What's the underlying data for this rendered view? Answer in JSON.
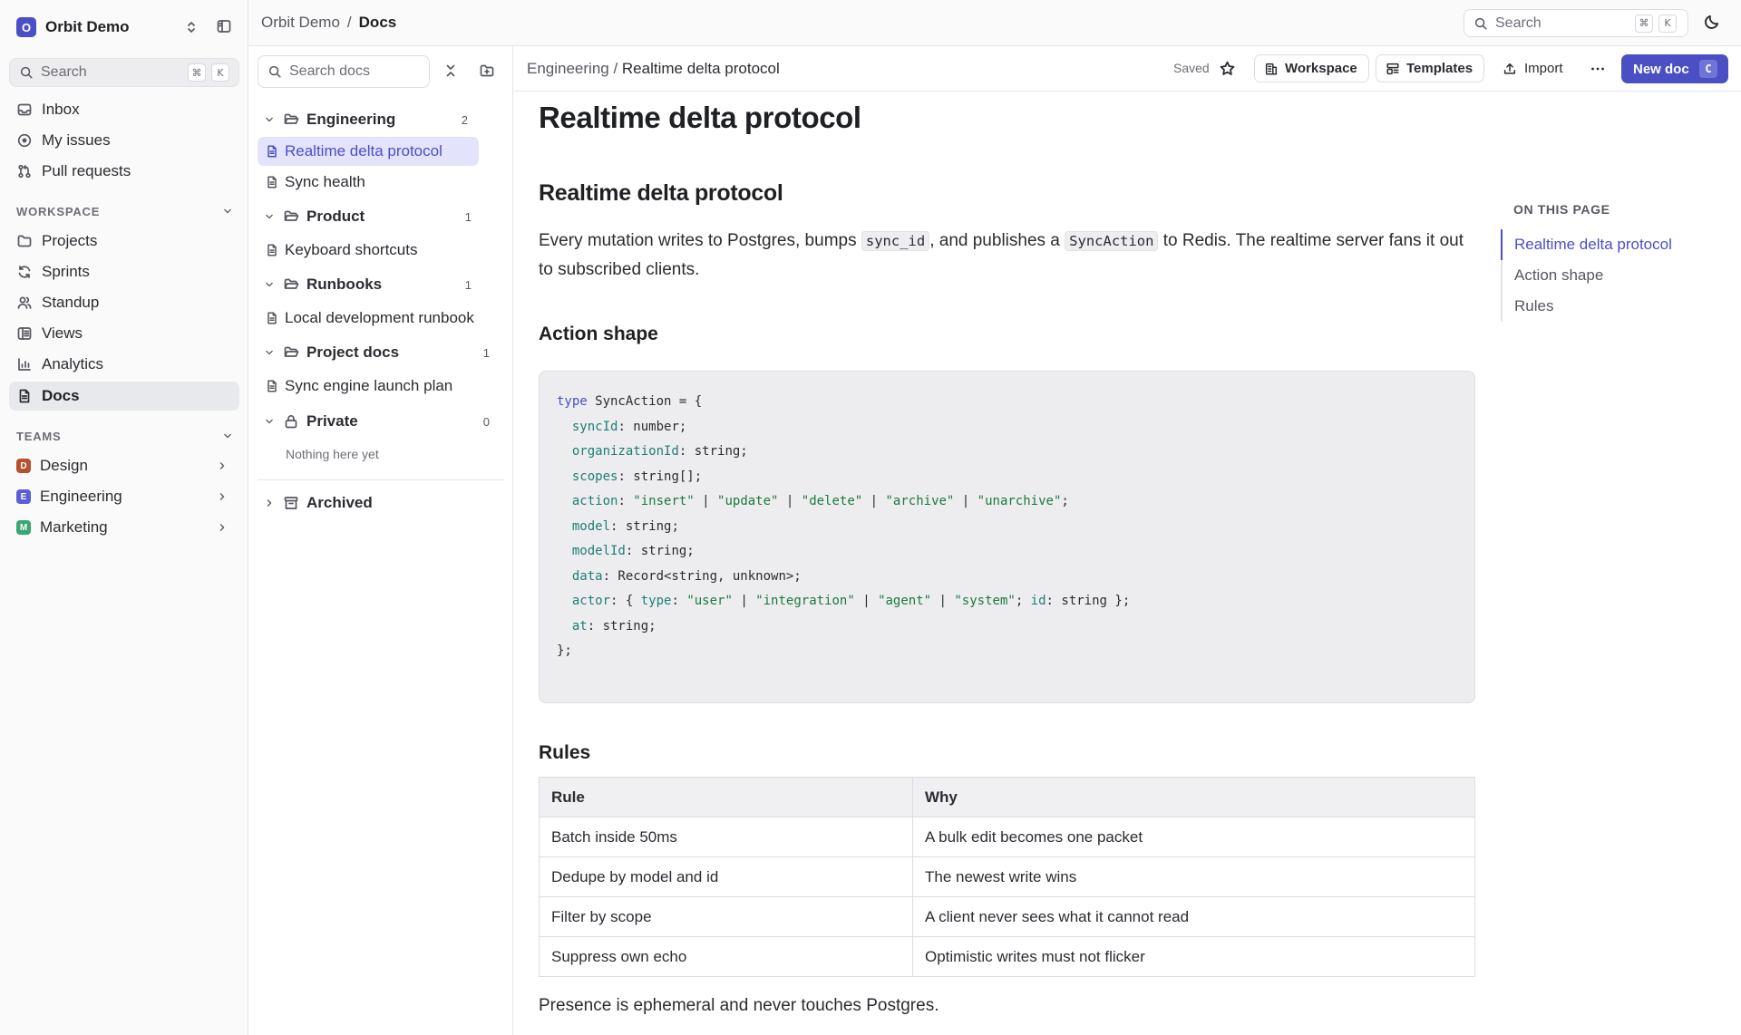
{
  "workspace": {
    "initial": "O",
    "name": "Orbit Demo"
  },
  "sidebar": {
    "search_placeholder": "Search",
    "search_keys": [
      "⌘",
      "K"
    ],
    "nav": [
      {
        "label": "Inbox",
        "icon": "inbox-icon"
      },
      {
        "label": "My issues",
        "icon": "issue-icon"
      },
      {
        "label": "Pull requests",
        "icon": "pull-request-icon"
      }
    ],
    "workspace_section": {
      "title": "WORKSPACE",
      "items": [
        {
          "label": "Projects",
          "icon": "folder-icon"
        },
        {
          "label": "Sprints",
          "icon": "cycle-icon"
        },
        {
          "label": "Standup",
          "icon": "users-icon"
        },
        {
          "label": "Views",
          "icon": "views-icon"
        },
        {
          "label": "Analytics",
          "icon": "chart-icon"
        },
        {
          "label": "Docs",
          "icon": "doc-icon",
          "active": true
        }
      ]
    },
    "teams_section": {
      "title": "TEAMS",
      "items": [
        {
          "initial": "D",
          "label": "Design",
          "color": "#b5532e"
        },
        {
          "initial": "E",
          "label": "Engineering",
          "color": "#5b5fd6"
        },
        {
          "initial": "M",
          "label": "Marketing",
          "color": "#3aa772"
        }
      ]
    }
  },
  "topbar": {
    "breadcrumb": [
      "Orbit Demo",
      "/",
      "Docs"
    ],
    "search_placeholder": "Search",
    "search_keys": [
      "⌘",
      "K"
    ]
  },
  "tree": {
    "search_placeholder": "Search docs",
    "folders": [
      {
        "name": "Engineering",
        "count": "2",
        "docs": [
          "Realtime delta protocol",
          "Sync health"
        ]
      },
      {
        "name": "Product",
        "count": "1",
        "docs": [
          "Keyboard shortcuts"
        ]
      },
      {
        "name": "Runbooks",
        "count": "1",
        "docs": [
          "Local development runbook"
        ]
      },
      {
        "name": "Project docs",
        "count": "1",
        "docs": [
          "Sync engine launch plan"
        ]
      },
      {
        "name": "Private",
        "count": "0",
        "empty_text": "Nothing here yet"
      },
      {
        "name": "Archived"
      }
    ],
    "active_doc": "Realtime delta protocol"
  },
  "doc_toolbar": {
    "breadcrumb_parent": "Engineering / ",
    "breadcrumb_current": "Realtime delta protocol",
    "saved": "Saved",
    "workspace_btn": "Workspace",
    "templates_btn": "Templates",
    "import_btn": "Import",
    "new_doc_btn": "New doc",
    "new_doc_key": "C"
  },
  "document": {
    "title": "Realtime delta protocol",
    "h1": "Realtime delta protocol",
    "intro": {
      "t1": "Every mutation writes to Postgres, bumps ",
      "c1": "sync_id",
      "t2": ", and publishes a ",
      "c2": "SyncAction",
      "t3": " to Redis. The realtime server fans it out to subscribed clients."
    },
    "h_action": "Action shape",
    "code_lines": [
      "type SyncAction = {",
      "  syncId: number;",
      "  organizationId: string;",
      "  scopes: string[];",
      "  action: \"insert\" | \"update\" | \"delete\" | \"archive\" | \"unarchive\";",
      "  model: string;",
      "  modelId: string;",
      "  data: Record<string, unknown>;",
      "  actor: { type: \"user\" | \"integration\" | \"agent\" | \"system\"; id: string };",
      "  at: string;",
      "};"
    ],
    "h_rules": "Rules",
    "rules_table": {
      "headers": [
        "Rule",
        "Why"
      ],
      "rows": [
        [
          "Batch inside 50ms",
          "A bulk edit becomes one packet"
        ],
        [
          "Dedupe by model and id",
          "The newest write wins"
        ],
        [
          "Filter by scope",
          "A client never sees what it cannot read"
        ],
        [
          "Suppress own echo",
          "Optimistic writes must not flicker"
        ]
      ]
    },
    "footer": "Presence is ephemeral and never touches Postgres."
  },
  "on_this_page": {
    "title": "ON THIS PAGE",
    "items": [
      "Realtime delta protocol",
      "Action shape",
      "Rules"
    ]
  },
  "colors": {
    "accent": "#4b4fc4",
    "accent_bg": "#e3e4fb"
  }
}
